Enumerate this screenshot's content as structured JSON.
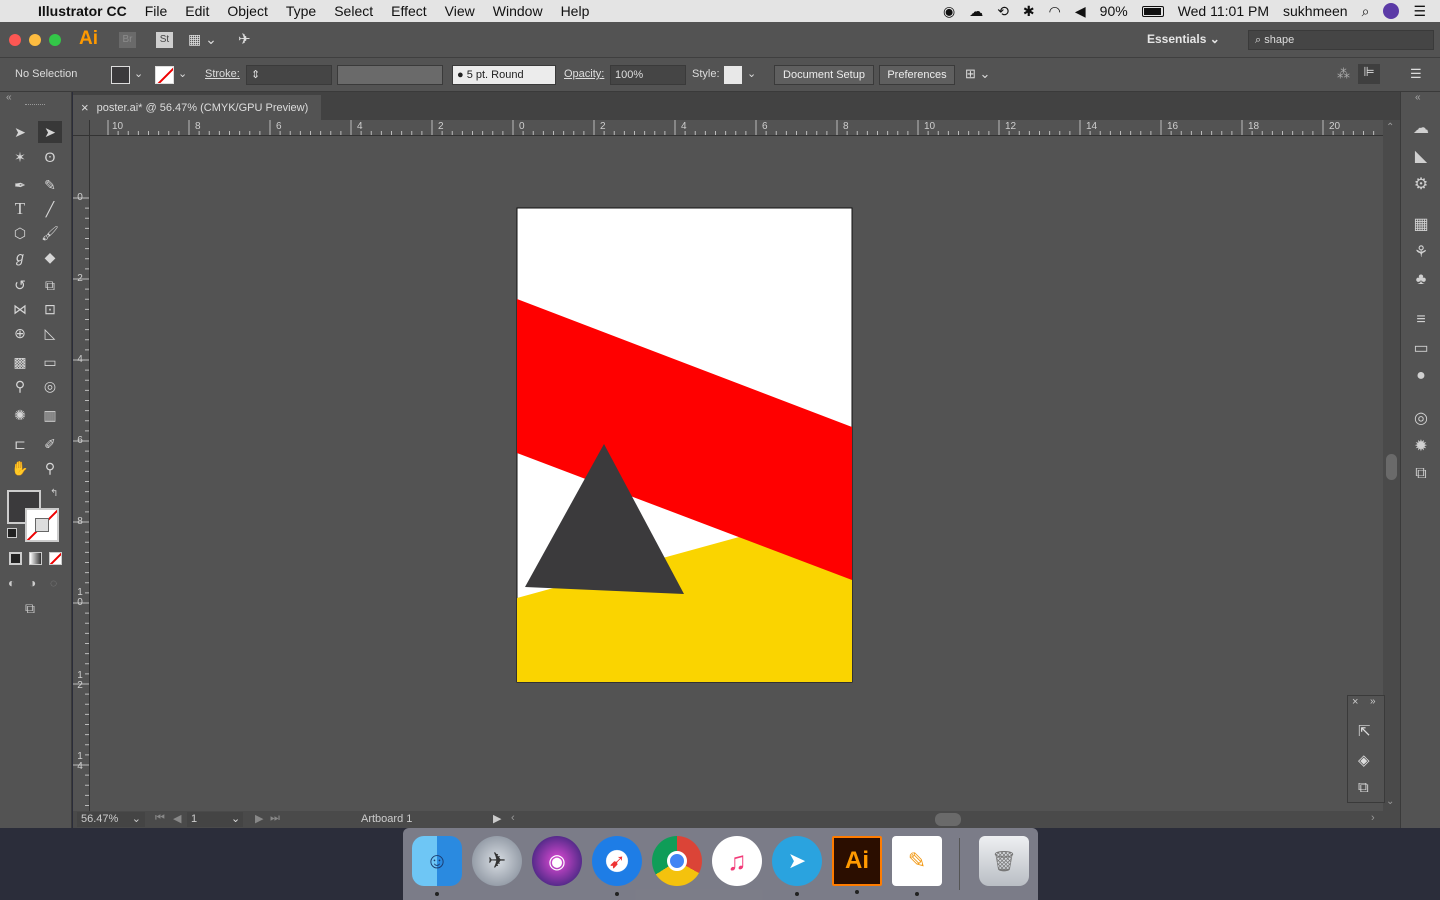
{
  "menubar": {
    "app_name": "Illustrator CC",
    "items": [
      "File",
      "Edit",
      "Object",
      "Type",
      "Select",
      "Effect",
      "View",
      "Window",
      "Help"
    ],
    "battery": "90%",
    "clock": "Wed 11:01 PM",
    "user": "sukhmeen"
  },
  "appbar": {
    "ai_logo": "Ai",
    "br_logo": "Br",
    "st_logo": "St",
    "workspace": "Essentials",
    "search_value": "shape"
  },
  "control": {
    "selection": "No Selection",
    "stroke_label": "Stroke:",
    "brush": "5 pt. Round",
    "opacity_label": "Opacity:",
    "opacity_value": "100%",
    "style_label": "Style:",
    "document_setup": "Document Setup",
    "preferences": "Preferences"
  },
  "document": {
    "tab_title": "poster.ai* @ 56.47% (CMYK/GPU Preview)",
    "close": "×"
  },
  "rulers": {
    "top": [
      "10",
      "8",
      "6",
      "4",
      "2",
      "0",
      "2",
      "4",
      "6",
      "8",
      "10",
      "12",
      "14",
      "16",
      "18",
      "20"
    ],
    "left": [
      "0",
      "2",
      "4",
      "6",
      "8",
      "10",
      "12",
      "14"
    ]
  },
  "status": {
    "zoom": "56.47%",
    "artboard_number": "1",
    "artboard_name": "Artboard 1"
  },
  "artwork": {
    "background": "#ffffff",
    "band_red": "#ff0000",
    "band_yellow": "#fad400",
    "triangle": "#3b3a3c"
  },
  "colors": {
    "ui_panel": "#535353",
    "canvas": "#535353",
    "fill_swatch": "#3b3a3c"
  }
}
